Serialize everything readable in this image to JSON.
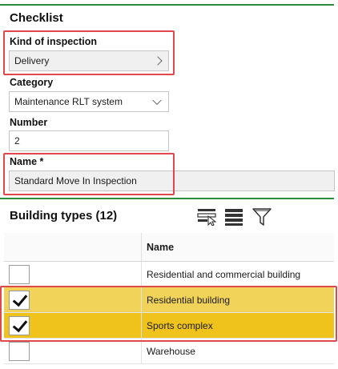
{
  "checklist": {
    "title": "Checklist",
    "kind_of_inspection": {
      "label": "Kind of inspection",
      "value": "Delivery"
    },
    "category": {
      "label": "Category",
      "value": "Maintenance RLT system"
    },
    "number": {
      "label": "Number",
      "value": "2"
    },
    "name": {
      "label": "Name *",
      "value": "Standard Move In Inspection"
    }
  },
  "building_types": {
    "title": "Building types (12)",
    "toolbar": [
      "select-rows-icon",
      "list-view-icon",
      "filter-icon"
    ],
    "columns": [
      "",
      "Name"
    ],
    "rows": [
      {
        "name": "Residential and commercial building",
        "checked": false
      },
      {
        "name": "Residential building",
        "checked": true
      },
      {
        "name": "Sports complex",
        "checked": true
      },
      {
        "name": "Warehouse",
        "checked": false
      }
    ]
  },
  "colors": {
    "accent_green": "#2e8b3d",
    "highlight_red": "#e0484c",
    "selected_row_light": "#f2d35a",
    "selected_row_dark": "#efc31b"
  }
}
